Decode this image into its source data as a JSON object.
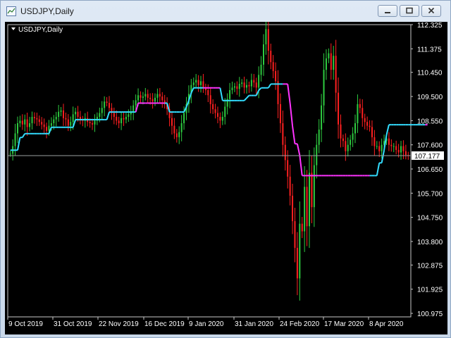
{
  "window": {
    "title": "USDJPY,Daily",
    "chart_label": "USDJPY,Daily"
  },
  "icons": {
    "app": "chart-window-icon",
    "minimize": "minimize-icon",
    "maximize": "maximize-icon",
    "close": "close-icon",
    "dropdown": "triangle-down-icon"
  },
  "colors": {
    "background": "#000000",
    "bull": "#2ecc40",
    "bear": "#ff2020",
    "line_up": "#33ddff",
    "line_down": "#ff33ff",
    "text": "#ffffff",
    "price_line": "#9aa0a0"
  },
  "chart_data": {
    "type": "candlestick",
    "symbol": "USDJPY",
    "timeframe": "Daily",
    "ylim": [
      100.975,
      112.325
    ],
    "y_ticks": [
      "112.325",
      "111.375",
      "110.450",
      "109.500",
      "108.550",
      "107.600",
      "106.650",
      "105.700",
      "104.750",
      "103.800",
      "102.875",
      "101.925",
      "100.975"
    ],
    "x_ticks": [
      "9 Oct 2019",
      "31 Oct 2019",
      "22 Nov 2019",
      "16 Dec 2019",
      "9 Jan 2020",
      "31 Jan 2020",
      "24 Feb 2020",
      "17 Mar 2020",
      "8 Apr 2020"
    ],
    "current_price": "107.177",
    "closes": [
      107.25,
      107.55,
      108.05,
      108.45,
      108.55,
      108.4,
      108.6,
      108.3,
      108.45,
      108.7,
      108.65,
      108.6,
      108.5,
      108.4,
      108.3,
      108.15,
      108.35,
      108.45,
      108.6,
      108.7,
      108.9,
      108.95,
      108.65,
      108.6,
      108.35,
      108.5,
      108.8,
      108.9,
      108.7,
      108.6,
      108.55,
      108.65,
      108.5,
      108.45,
      108.4,
      108.55,
      108.7,
      108.85,
      109.05,
      109.3,
      109.25,
      109.05,
      108.85,
      108.7,
      108.55,
      108.45,
      108.65,
      108.6,
      108.7,
      108.8,
      108.9,
      109.15,
      109.35,
      109.55,
      109.45,
      109.5,
      109.6,
      109.45,
      109.4,
      109.3,
      109.45,
      109.6,
      109.5,
      109.35,
      109.2,
      109.0,
      108.65,
      108.35,
      108.05,
      107.9,
      108.1,
      108.45,
      108.85,
      109.2,
      109.6,
      109.95,
      110.05,
      110.15,
      109.95,
      110.1,
      109.85,
      109.75,
      109.55,
      109.2,
      109.0,
      108.85,
      108.7,
      108.55,
      108.7,
      109.1,
      109.4,
      109.75,
      109.85,
      109.9,
      109.8,
      110.0,
      110.05,
      109.85,
      109.95,
      109.9,
      110.15,
      110.05,
      109.85,
      110.35,
      110.75,
      111.55,
      112.15,
      111.3,
      110.85,
      110.5,
      110.1,
      109.2,
      108.45,
      107.6,
      107.0,
      106.35,
      105.6,
      104.6,
      103.55,
      102.35,
      104.5,
      104.2,
      105.95,
      104.4,
      106.5,
      105.15,
      106.8,
      107.6,
      108.2,
      109.15,
      110.55,
      111.0,
      111.2,
      110.55,
      111.1,
      109.65,
      108.4,
      107.85,
      107.75,
      107.35,
      107.6,
      107.8,
      108.05,
      108.45,
      109.2,
      109.05,
      108.65,
      108.5,
      108.35,
      108.3,
      107.9,
      107.55,
      107.55,
      107.35,
      107.6,
      107.75,
      107.85,
      107.6,
      107.55,
      107.55,
      107.4,
      107.3,
      107.55,
      107.35,
      107.2,
      107.18
    ],
    "trail_stop": [
      107.39,
      107.39,
      107.39,
      107.39,
      107.89,
      107.89,
      108.04,
      108.04,
      108.04,
      108.04,
      108.04,
      108.04,
      108.04,
      108.04,
      108.04,
      108.04,
      108.04,
      108.29,
      108.29,
      108.29,
      108.29,
      108.29,
      108.29,
      108.29,
      108.29,
      108.29,
      108.29,
      108.59,
      108.59,
      108.59,
      108.59,
      108.59,
      108.59,
      108.59,
      108.59,
      108.59,
      108.59,
      108.59,
      108.59,
      108.59,
      108.59,
      108.89,
      108.89,
      108.89,
      108.89,
      108.89,
      108.89,
      108.89,
      108.89,
      108.89,
      108.89,
      108.89,
      108.89,
      109.24,
      109.24,
      109.24,
      109.24,
      109.24,
      109.24,
      109.24,
      109.24,
      109.24,
      109.24,
      109.24,
      109.24,
      109.24,
      108.89,
      108.89,
      108.89,
      108.89,
      108.89,
      108.89,
      108.89,
      109.09,
      109.34,
      109.64,
      109.84,
      109.84,
      109.84,
      109.84,
      109.84,
      109.84,
      109.84,
      109.84,
      109.84,
      109.84,
      109.84,
      109.84,
      109.34,
      109.34,
      109.34,
      109.34,
      109.34,
      109.34,
      109.34,
      109.34,
      109.34,
      109.34,
      109.44,
      109.54,
      109.54,
      109.54,
      109.54,
      109.74,
      109.84,
      109.84,
      109.84,
      109.84,
      109.99,
      109.99,
      109.99,
      109.99,
      109.99,
      109.99,
      109.99,
      109.99,
      109.24,
      108.34,
      107.64,
      107.64,
      107.19,
      106.39,
      106.39,
      106.39,
      106.39,
      106.39,
      106.39,
      106.39,
      106.39,
      106.39,
      106.39,
      106.39,
      106.39,
      106.39,
      106.39,
      106.39,
      106.39,
      106.39,
      106.39,
      106.39,
      106.39,
      106.39,
      106.39,
      106.39,
      106.39,
      106.39,
      106.39,
      106.39,
      106.39,
      106.39,
      106.39,
      106.39,
      106.39,
      106.89,
      106.89,
      107.39,
      107.99,
      108.39,
      108.39,
      108.39,
      108.39,
      108.39,
      108.39,
      108.39,
      108.39,
      108.39,
      108.39,
      108.39,
      108.39,
      108.39,
      108.39,
      108.39,
      108.39,
      108.39
    ],
    "trail_up": [
      true,
      true,
      true,
      true,
      true,
      true,
      true,
      true,
      true,
      true,
      true,
      true,
      true,
      true,
      true,
      true,
      true,
      true,
      true,
      true,
      true,
      true,
      true,
      true,
      true,
      true,
      true,
      true,
      true,
      true,
      true,
      true,
      true,
      true,
      true,
      true,
      true,
      true,
      true,
      true,
      true,
      true,
      true,
      true,
      true,
      true,
      true,
      true,
      true,
      true,
      true,
      true,
      true,
      false,
      false,
      false,
      false,
      false,
      false,
      false,
      false,
      false,
      false,
      false,
      false,
      true,
      true,
      true,
      true,
      true,
      true,
      true,
      true,
      true,
      true,
      true,
      true,
      true,
      true,
      true,
      true,
      false,
      false,
      false,
      false,
      false,
      false,
      false,
      true,
      true,
      true,
      true,
      true,
      true,
      true,
      true,
      true,
      true,
      true,
      true,
      true,
      true,
      true,
      true,
      true,
      true,
      true,
      true,
      true,
      true,
      true,
      true,
      true,
      true,
      false,
      false,
      false,
      false,
      false,
      false,
      false,
      false,
      false,
      false,
      false,
      false,
      false,
      false,
      false,
      false,
      false,
      false,
      false,
      false,
      false,
      false,
      false,
      false,
      false,
      false,
      false,
      false,
      false,
      false,
      false,
      false,
      false,
      false,
      false,
      false,
      true,
      true,
      true,
      true,
      true,
      true,
      true,
      true,
      true,
      true,
      true,
      true,
      true,
      true,
      true,
      true,
      true,
      true,
      true,
      true,
      true,
      true,
      true
    ]
  }
}
